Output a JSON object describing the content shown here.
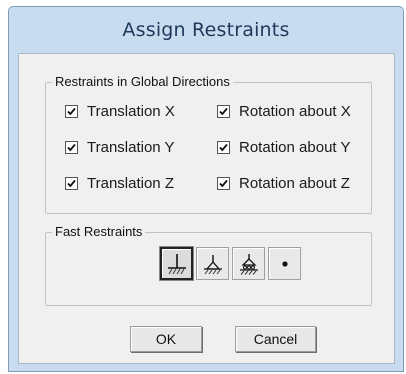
{
  "window": {
    "title": "Assign Restraints"
  },
  "restraints": {
    "legend": "Restraints in Global Directions",
    "items": [
      {
        "label": "Translation X",
        "checked": true
      },
      {
        "label": "Rotation about X",
        "checked": true
      },
      {
        "label": "Translation Y",
        "checked": true
      },
      {
        "label": "Rotation about Y",
        "checked": true
      },
      {
        "label": "Translation Z",
        "checked": true
      },
      {
        "label": "Rotation about Z",
        "checked": true
      }
    ]
  },
  "fast_restraints": {
    "legend": "Fast Restraints",
    "buttons": [
      {
        "icon": "fixed-support-icon",
        "selected": true
      },
      {
        "icon": "pinned-support-icon",
        "selected": false
      },
      {
        "icon": "roller-support-icon",
        "selected": false
      },
      {
        "icon": "free-point-icon",
        "selected": false
      }
    ]
  },
  "actions": {
    "ok_label": "OK",
    "cancel_label": "Cancel"
  }
}
